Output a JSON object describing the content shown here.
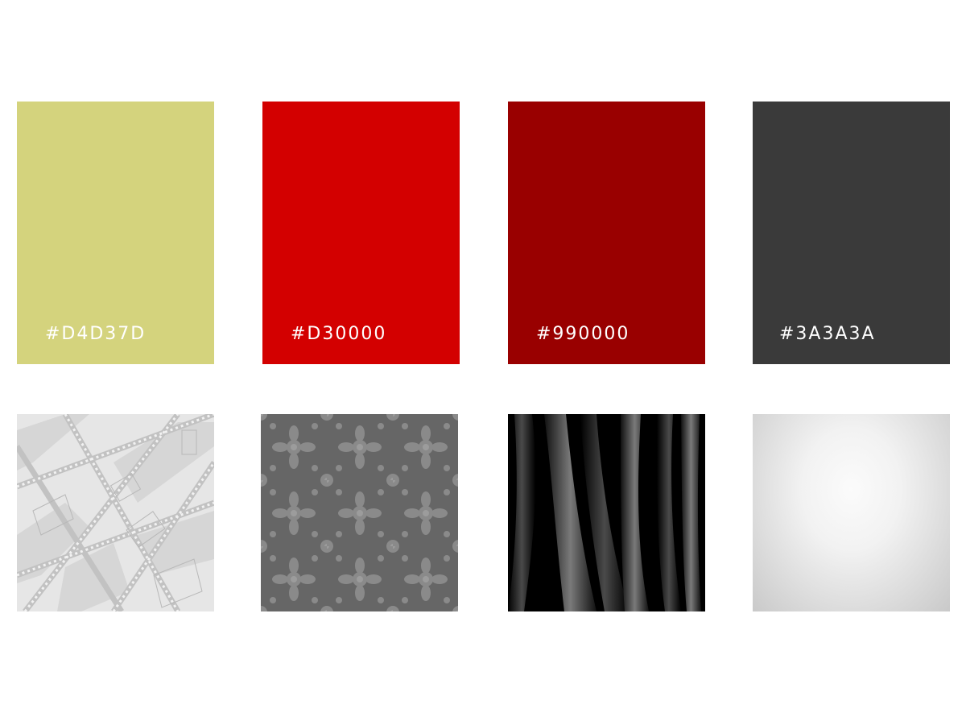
{
  "swatches": [
    {
      "label": "#D4D37D",
      "color": "#D4D37D"
    },
    {
      "label": "#D30000",
      "color": "#D30000"
    },
    {
      "label": "#990000",
      "color": "#990000"
    },
    {
      "label": "#3A3A3A",
      "color": "#3A3A3A"
    }
  ],
  "textures": [
    {
      "name": "map-texture-image"
    },
    {
      "name": "damask-texture-image"
    },
    {
      "name": "curtain-texture-image"
    },
    {
      "name": "silver-gradient-texture-image"
    }
  ]
}
